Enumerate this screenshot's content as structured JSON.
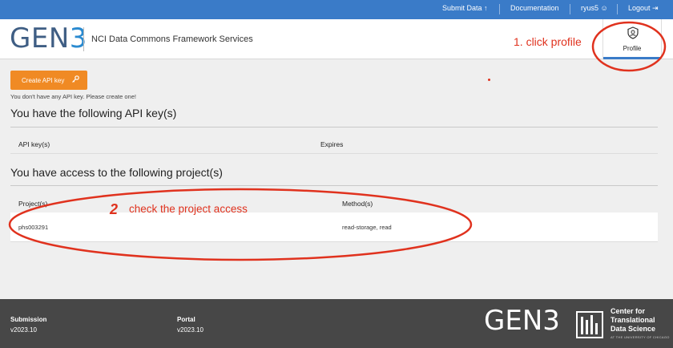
{
  "topbar": {
    "submit_data": "Submit Data",
    "documentation": "Documentation",
    "user": "ryus5",
    "logout": "Logout"
  },
  "header": {
    "logo_prefix": "GEN",
    "logo_suffix": "3",
    "subtitle": "NCI Data Commons Framework Services",
    "profile_tab": "Profile"
  },
  "api": {
    "button_label": "Create API key",
    "no_key_message": "You don't have any API key. Please create one!",
    "section_title": "You have the following API key(s)",
    "columns": [
      "API key(s)",
      "Expires"
    ]
  },
  "projects": {
    "section_title": "You have access to the following project(s)",
    "columns": [
      "Project(s)",
      "Method(s)"
    ],
    "rows": [
      {
        "project": "phs003291",
        "methods": "read-storage, read"
      }
    ]
  },
  "footer": {
    "submission_label": "Submission",
    "submission_version": "v2023.10",
    "portal_label": "Portal",
    "portal_version": "v2023.10",
    "logo_prefix": "GEN",
    "logo_suffix": "3",
    "ctds_line1": "Center for",
    "ctds_line2": "Translational",
    "ctds_line3": "Data Science",
    "ctds_small": "AT THE UNIVERSITY OF CHICAGO"
  },
  "annotations": {
    "step1": "1. click profile",
    "step2_number": "2",
    "step2_text": "check the project access",
    "color": "#e0321e"
  },
  "colors": {
    "topbar": "#3a7bc8",
    "button": "#f08a24",
    "footer": "#474747"
  },
  "icons": [
    "upload-icon",
    "user-circle-icon",
    "logout-icon",
    "profile-shield-icon",
    "key-icon",
    "ctds-logo-icon"
  ]
}
